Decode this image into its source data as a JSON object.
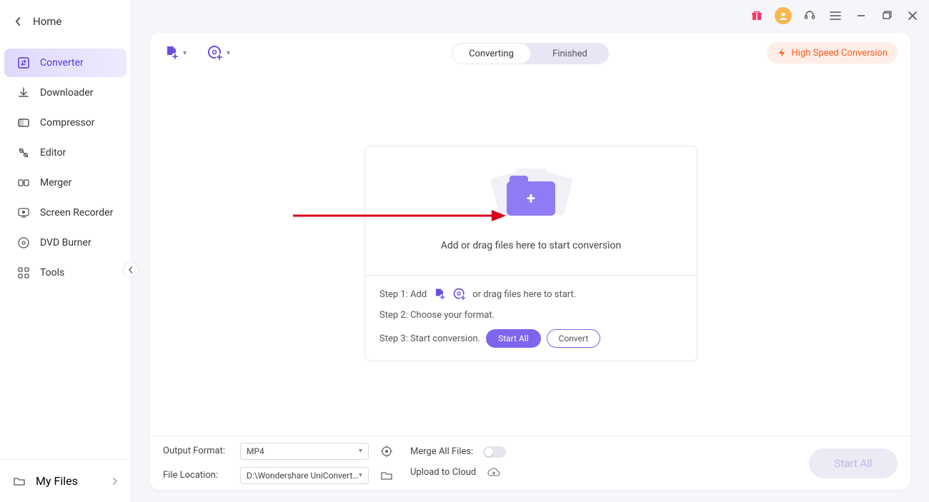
{
  "sidebar": {
    "home": "Home",
    "items": [
      {
        "label": "Converter"
      },
      {
        "label": "Downloader"
      },
      {
        "label": "Compressor"
      },
      {
        "label": "Editor"
      },
      {
        "label": "Merger"
      },
      {
        "label": "Screen Recorder"
      },
      {
        "label": "DVD Burner"
      },
      {
        "label": "Tools"
      }
    ],
    "my_files": "My Files"
  },
  "toolbar": {
    "tab_converting": "Converting",
    "tab_finished": "Finished",
    "high_speed": "High Speed Conversion"
  },
  "dropzone": {
    "prompt": "Add or drag files here to start conversion",
    "step1_a": "Step 1: Add",
    "step1_b": "or drag files here to start.",
    "step2": "Step 2: Choose your format.",
    "step3": "Step 3: Start conversion.",
    "start_all": "Start All",
    "convert": "Convert"
  },
  "bottom": {
    "output_format_label": "Output Format:",
    "output_format_value": "MP4",
    "file_location_label": "File Location:",
    "file_location_value": "D:\\Wondershare UniConverter ",
    "merge_label": "Merge All Files:",
    "upload_label": "Upload to Cloud",
    "start_all": "Start All"
  }
}
